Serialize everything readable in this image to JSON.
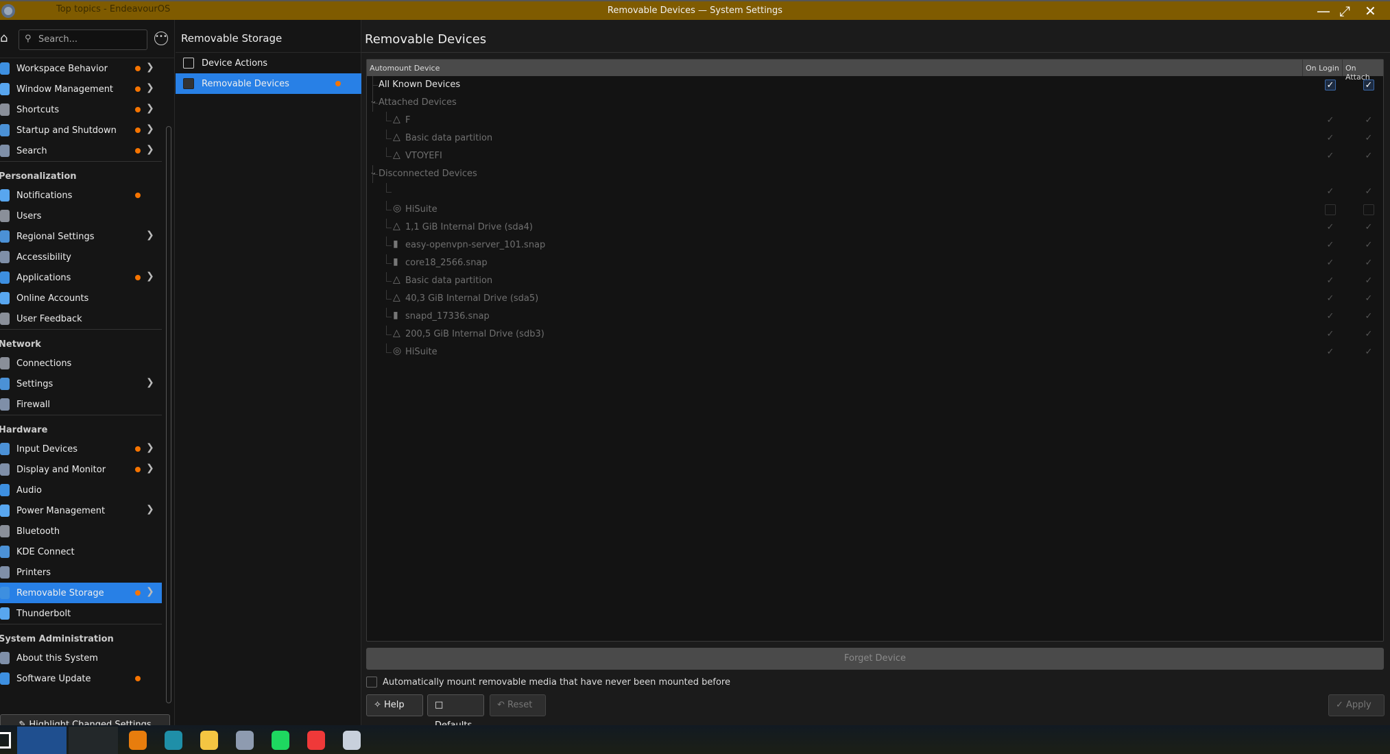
{
  "window": {
    "title": "Removable Devices — System Settings",
    "background_title": "Top topics - EndeavourOS",
    "accent": "#2880e6",
    "titlebar_color": "#7f5b00"
  },
  "sidebar": {
    "search_placeholder": "Search...",
    "groups": [
      {
        "header": "",
        "items": [
          {
            "label": "Workspace Behavior",
            "dot": true,
            "arrow": true
          },
          {
            "label": "Window Management",
            "dot": true,
            "arrow": true
          },
          {
            "label": "Shortcuts",
            "dot": true,
            "arrow": true
          },
          {
            "label": "Startup and Shutdown",
            "dot": true,
            "arrow": true
          },
          {
            "label": "Search",
            "dot": true,
            "arrow": true
          }
        ]
      },
      {
        "header": "Personalization",
        "items": [
          {
            "label": "Notifications",
            "dot": true
          },
          {
            "label": "Users"
          },
          {
            "label": "Regional Settings",
            "arrow": true
          },
          {
            "label": "Accessibility"
          },
          {
            "label": "Applications",
            "dot": true,
            "arrow": true
          },
          {
            "label": "Online Accounts"
          },
          {
            "label": "User Feedback"
          }
        ]
      },
      {
        "header": "Network",
        "items": [
          {
            "label": "Connections"
          },
          {
            "label": "Settings",
            "arrow": true
          },
          {
            "label": "Firewall"
          }
        ]
      },
      {
        "header": "Hardware",
        "items": [
          {
            "label": "Input Devices",
            "dot": true,
            "arrow": true
          },
          {
            "label": "Display and Monitor",
            "dot": true,
            "arrow": true
          },
          {
            "label": "Audio"
          },
          {
            "label": "Power Management",
            "arrow": true
          },
          {
            "label": "Bluetooth"
          },
          {
            "label": "KDE Connect"
          },
          {
            "label": "Printers"
          },
          {
            "label": "Removable Storage",
            "dot": true,
            "arrow": true,
            "selected": true
          },
          {
            "label": "Thunderbolt"
          }
        ]
      },
      {
        "header": "System Administration",
        "items": [
          {
            "label": "About this System"
          },
          {
            "label": "Software Update",
            "dot": true
          }
        ]
      }
    ],
    "highlight_button": "Highlight Changed Settings"
  },
  "middle": {
    "title": "Removable Storage",
    "items": [
      {
        "label": "Device Actions"
      },
      {
        "label": "Removable Devices",
        "selected": true,
        "dot": true
      }
    ]
  },
  "main": {
    "title": "Removable Devices",
    "columns": [
      "Automount Device",
      "On Login",
      "On Attach"
    ],
    "rows": [
      {
        "label": "All Known Devices",
        "level": 0,
        "login": "checked",
        "attach": "checked"
      },
      {
        "label": "Attached Devices",
        "level": 0,
        "category": true
      },
      {
        "label": "F",
        "level": 1,
        "icon": "drive-icon",
        "login": "disabled",
        "attach": "disabled"
      },
      {
        "label": "Basic data partition",
        "level": 1,
        "icon": "drive-icon",
        "login": "disabled",
        "attach": "disabled"
      },
      {
        "label": "VTOYEFI",
        "level": 1,
        "icon": "drive-icon",
        "login": "disabled",
        "attach": "disabled"
      },
      {
        "label": "Disconnected Devices",
        "level": 0,
        "category": true
      },
      {
        "label": "",
        "level": 1,
        "login": "disabled",
        "attach": "disabled"
      },
      {
        "label": "HiSuite",
        "level": 1,
        "icon": "optical-disc-icon",
        "login": "empty",
        "attach": "empty"
      },
      {
        "label": "1,1 GiB Internal Drive (sda4)",
        "level": 1,
        "icon": "drive-icon",
        "login": "disabled",
        "attach": "disabled"
      },
      {
        "label": "easy-openvpn-server_101.snap",
        "level": 1,
        "icon": "file-icon",
        "login": "disabled",
        "attach": "disabled"
      },
      {
        "label": "core18_2566.snap",
        "level": 1,
        "icon": "file-icon",
        "login": "disabled",
        "attach": "disabled"
      },
      {
        "label": "Basic data partition",
        "level": 1,
        "icon": "drive-icon",
        "login": "disabled",
        "attach": "disabled"
      },
      {
        "label": "40,3 GiB Internal Drive (sda5)",
        "level": 1,
        "icon": "drive-icon",
        "login": "disabled",
        "attach": "disabled"
      },
      {
        "label": "snapd_17336.snap",
        "level": 1,
        "icon": "file-icon",
        "login": "disabled",
        "attach": "disabled"
      },
      {
        "label": "200,5 GiB Internal Drive (sdb3)",
        "level": 1,
        "icon": "drive-icon",
        "login": "disabled",
        "attach": "disabled"
      },
      {
        "label": "HiSuite",
        "level": 1,
        "icon": "optical-disc-icon",
        "login": "disabled",
        "attach": "disabled"
      }
    ],
    "forget_button": "Forget Device",
    "automount_label": "Automatically mount removable media that have never been mounted before",
    "automount_checked": false,
    "buttons": {
      "help": "Help",
      "defaults": "Defaults",
      "reset": "Reset",
      "apply": "Apply"
    }
  },
  "taskbar": {
    "apps": [
      "blender",
      "simplenote",
      "files",
      "calculator",
      "spotify",
      "vivaldi",
      "system-settings"
    ]
  }
}
